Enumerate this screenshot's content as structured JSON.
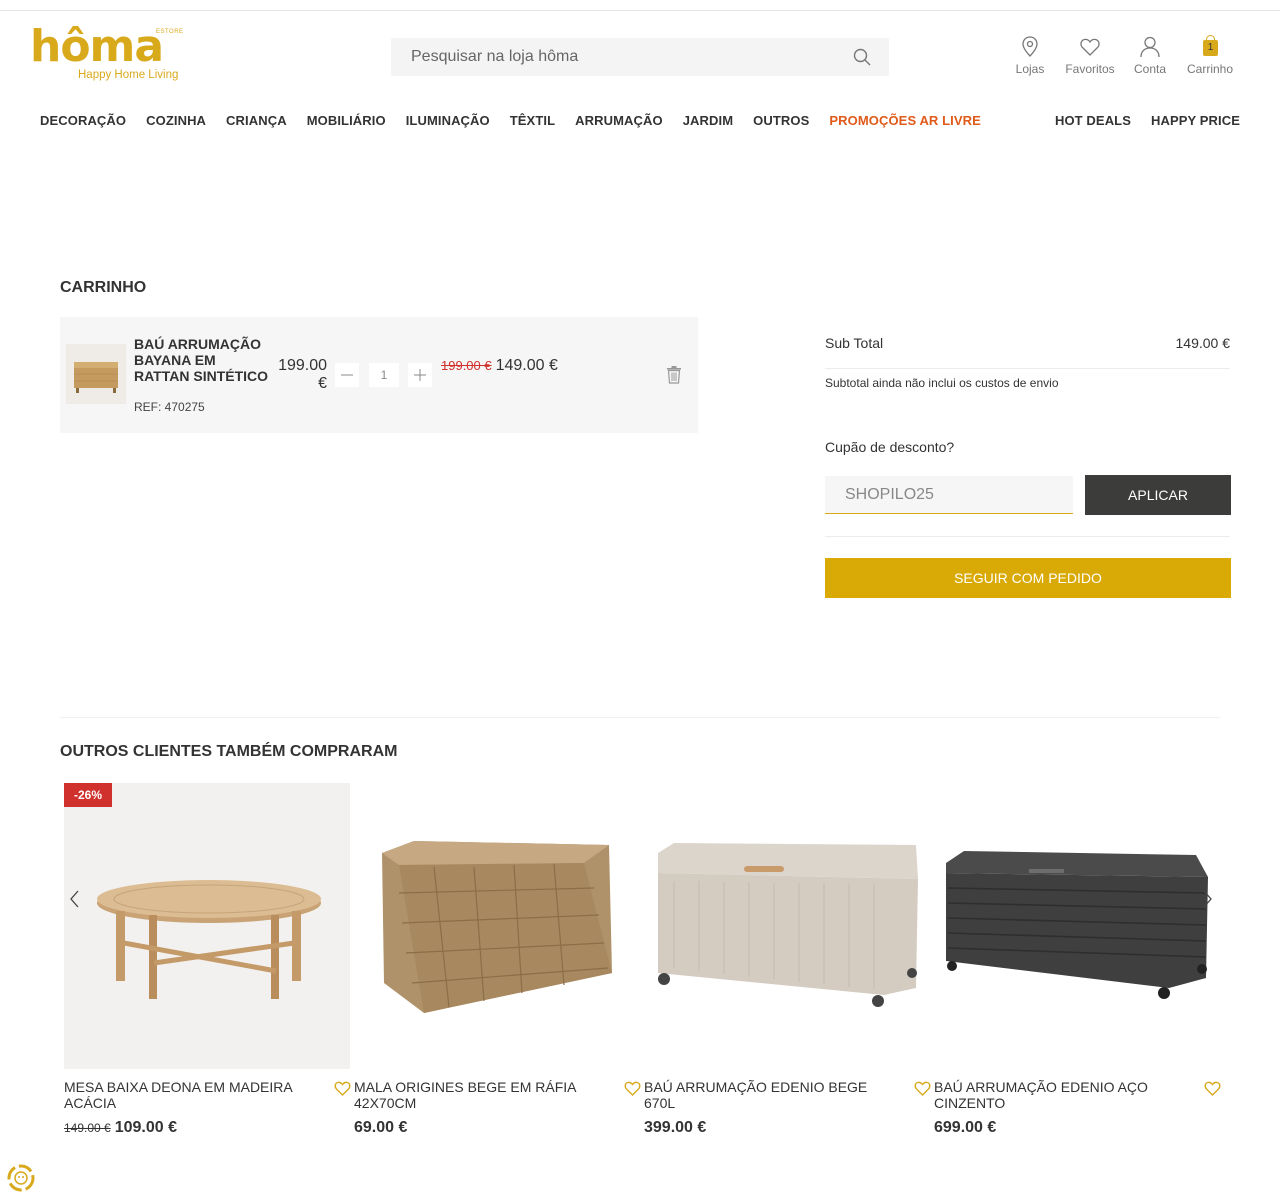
{
  "header": {
    "logo_text": "hôma",
    "logo_estore": "ESTORE",
    "logo_tagline": "Happy Home Living",
    "search_placeholder": "Pesquisar na loja hôma",
    "links": [
      {
        "label": "Lojas",
        "icon": "location-pin-icon"
      },
      {
        "label": "Favoritos",
        "icon": "heart-icon"
      },
      {
        "label": "Conta",
        "icon": "user-icon"
      },
      {
        "label": "Carrinho",
        "icon": "cart-bag-icon",
        "count": "1"
      }
    ]
  },
  "nav": {
    "left": [
      "DECORAÇÃO",
      "COZINHA",
      "CRIANÇA",
      "MOBILIÁRIO",
      "ILUMINAÇÃO",
      "TÊXTIL",
      "ARRUMAÇÃO",
      "JARDIM",
      "OUTROS",
      "PROMOÇÕES AR LIVRE"
    ],
    "right": [
      "HOT DEALS",
      "HAPPY PRICE"
    ]
  },
  "cart": {
    "title": "CARRINHO",
    "item": {
      "name": "BAÚ ARRUMAÇÃO BAYANA EM RATTAN SINTÉTICO",
      "ref": "REF: 470275",
      "unit_price": "199.00 €",
      "quantity": "1",
      "old_total": "199.00 €",
      "total": "149.00 €"
    }
  },
  "summary": {
    "subtotal_label": "Sub Total",
    "subtotal_value": "149.00 €",
    "subtotal_note": "Subtotal ainda não inclui os custos de envio",
    "coupon_label": "Cupão de desconto?",
    "coupon_value": "SHOPILO25",
    "apply_label": "APLICAR",
    "checkout_label": "SEGUIR COM PEDIDO"
  },
  "recommendations": {
    "title": "OUTROS CLIENTES TAMBÉM COMPRARAM",
    "products": [
      {
        "name": "MESA BAIXA DEONA EM MADEIRA ACÁCIA",
        "old_price": "149.00 €",
        "price": "109.00 €",
        "badge": "-26%"
      },
      {
        "name": "MALA ORIGINES BEGE EM RÁFIA 42X70CM",
        "old_price": "",
        "price": "69.00 €",
        "badge": ""
      },
      {
        "name": "BAÚ ARRUMAÇÃO EDENIO BEGE 670L",
        "old_price": "",
        "price": "399.00 €",
        "badge": ""
      },
      {
        "name": "BAÚ ARRUMAÇÃO EDENIO AÇO CINZENTO",
        "old_price": "",
        "price": "699.00 €",
        "badge": ""
      }
    ]
  },
  "colors": {
    "brand": "#d9a91c",
    "checkout": "#d9aa06",
    "promo": "#e05a1a",
    "discount": "#d0312d",
    "dark_button": "#3c3c3b"
  }
}
